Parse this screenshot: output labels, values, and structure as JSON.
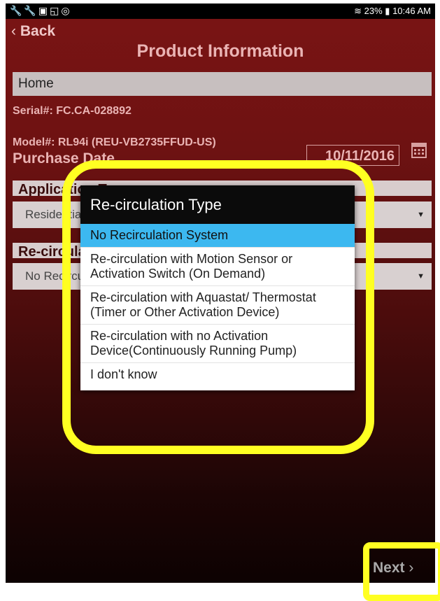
{
  "status_bar": {
    "left_icons": "🔧🔧▣◱◎",
    "battery": "23%",
    "time": "10:46 AM"
  },
  "header": {
    "back_label": "Back",
    "title": "Product Information"
  },
  "form": {
    "name_value": "Home",
    "serial": "Serial#: FC.CA-028892",
    "model": "Model#: RL94i (REU-VB2735FFUD-US)",
    "purchase_label": "Purchase Date",
    "purchase_date": "10/11/2016",
    "application_label": "Application Type:",
    "application_value": "Residential",
    "recirc_label": "Re-circulation Type:",
    "recirc_value": "No Recirculation System"
  },
  "dialog": {
    "title": "Re-circulation Type",
    "options": [
      "No Recirculation System",
      "Re-circulation with Motion Sensor or Activation Switch (On Demand)",
      "Re-circulation with Aquastat/ Thermostat (Timer or Other Activation Device)",
      "Re-circulation with no Activation Device(Continuously Running Pump)",
      "I don't know"
    ],
    "selected_index": 0
  },
  "footer": {
    "next_label": "Next"
  },
  "colors": {
    "highlight": "#ffff22",
    "selected": "#3cb8f0",
    "header_bg": "#7a1414"
  },
  "icons": [
    "wrench-icon",
    "calendar-icon",
    "dropdown-arrow-icon",
    "wifi-icon",
    "battery-icon"
  ]
}
